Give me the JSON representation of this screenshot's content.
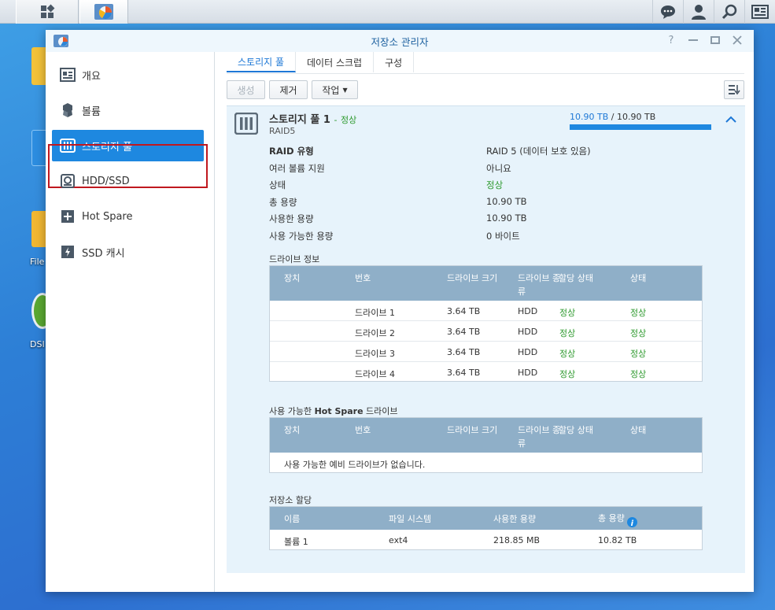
{
  "window": {
    "title": "저장소 관리자"
  },
  "sidebar": {
    "items": [
      {
        "label": "개요"
      },
      {
        "label": "볼륨"
      },
      {
        "label": "스토리지 풀"
      },
      {
        "label": "HDD/SSD"
      },
      {
        "label": "Hot Spare"
      },
      {
        "label": "SSD 캐시"
      }
    ]
  },
  "tabs": [
    {
      "label": "스토리지 풀"
    },
    {
      "label": "데이터 스크럽"
    },
    {
      "label": "구성"
    }
  ],
  "toolbar": {
    "create": "생성",
    "remove": "제거",
    "action": "작업"
  },
  "pool": {
    "name": "스토리지 풀 1",
    "status_sep": "-",
    "status": "정상",
    "raid": "RAID5",
    "used_cap": "10.90 TB",
    "cap_sep": "/",
    "total_cap": "10.90 TB",
    "used_fraction": 1.0,
    "properties": [
      {
        "label": "RAID 유형",
        "value": "RAID 5 (데이터 보호 있음)"
      },
      {
        "label": "여러 볼륨 지원",
        "value": "아니요"
      },
      {
        "label": "상태",
        "value": "정상"
      },
      {
        "label": "총 용량",
        "value": "10.90 TB"
      },
      {
        "label": "사용한 용량",
        "value": "10.90 TB"
      },
      {
        "label": "사용 가능한 용량",
        "value": "0 바이트"
      }
    ]
  },
  "drives": {
    "title": "드라이브 정보",
    "headers": {
      "device": "장치",
      "number": "번호",
      "size": "드라이브 크기",
      "type_line1": "드라이브 종",
      "type_line2": "류",
      "alloc": "할당 상태",
      "status": "상태"
    },
    "rows": [
      {
        "number": "드라이브 1",
        "size": "3.64 TB",
        "type": "HDD",
        "alloc": "정상",
        "status": "정상"
      },
      {
        "number": "드라이브 2",
        "size": "3.64 TB",
        "type": "HDD",
        "alloc": "정상",
        "status": "정상"
      },
      {
        "number": "드라이브 3",
        "size": "3.64 TB",
        "type": "HDD",
        "alloc": "정상",
        "status": "정상"
      },
      {
        "number": "드라이브 4",
        "size": "3.64 TB",
        "type": "HDD",
        "alloc": "정상",
        "status": "정상"
      }
    ]
  },
  "hotspare": {
    "title_prefix": "사용 가능한 ",
    "title_bold": "Hot Spare",
    "title_suffix": " 드라이브",
    "empty": "사용 가능한 예비 드라이브가 없습니다."
  },
  "allocation": {
    "title": "저장소 할당",
    "headers": {
      "name": "이름",
      "fs": "파일 시스템",
      "used": "사용한 용량",
      "total": "총 용량"
    },
    "rows": [
      {
        "name": "볼륨 1",
        "fs": "ext4",
        "used": "218.85 MB",
        "total": "10.82 TB"
      }
    ]
  },
  "desktop": {
    "labels": [
      "File",
      "DSI"
    ]
  },
  "colors": {
    "accent": "#1e88e0",
    "ok": "#2e9a2e",
    "grid_header": "#8fafc8",
    "selection_frame": "#c0181f"
  }
}
